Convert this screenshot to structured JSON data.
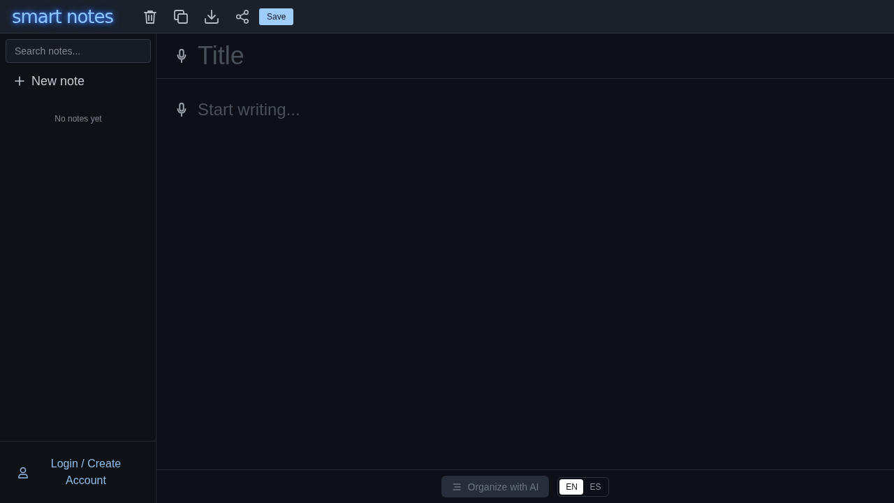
{
  "header": {
    "logo": "smart notes",
    "save_button": "Save"
  },
  "sidebar": {
    "search": {
      "placeholder": "Search notes..."
    },
    "new_note": "New note",
    "empty_message": "No notes yet",
    "login": "Login / Create Account"
  },
  "editor": {
    "title": {
      "placeholder": "Title"
    },
    "body": {
      "placeholder": "Start writing..."
    }
  },
  "footer": {
    "organize_button": {
      "label": "Organize with AI",
      "disabled": true
    },
    "languages": [
      {
        "label": "EN",
        "selected": true
      },
      {
        "label": "ES",
        "selected": false
      }
    ]
  }
}
